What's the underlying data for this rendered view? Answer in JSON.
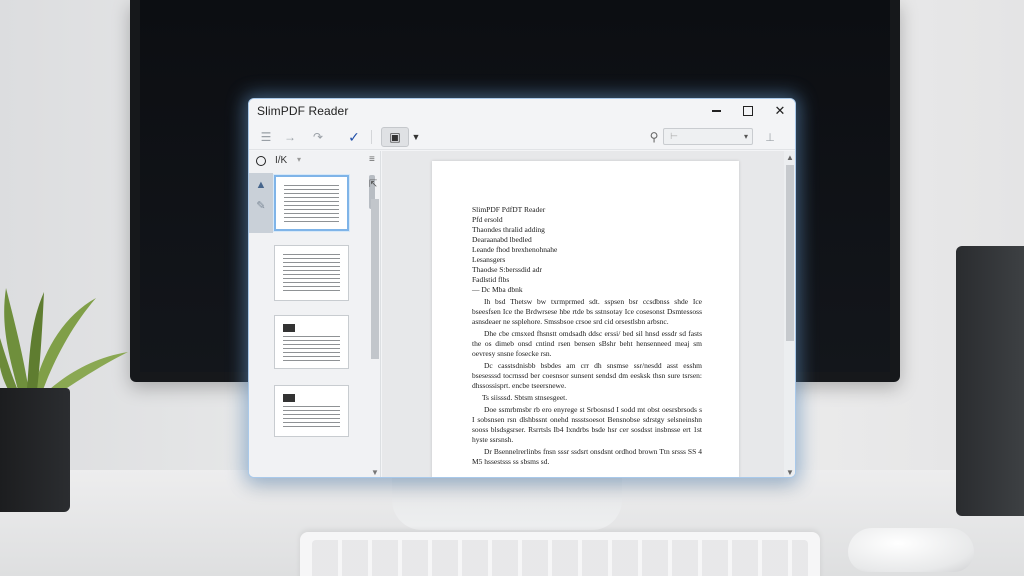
{
  "window": {
    "title": "SlimPDF Reader",
    "controls": {
      "minimize": "",
      "maximize": "",
      "close": "✕"
    }
  },
  "toolbar": {
    "list_icon": "☰",
    "forward_icon": "→",
    "redo_icon": "↷",
    "check_icon": "✓",
    "doc_icon": "▣",
    "doc_caret": "▼",
    "search_icon": "⚲",
    "zoom_value": "⊢",
    "zoom_caret": "▾",
    "extra_icon": "⊥"
  },
  "sidebar": {
    "label": "I/K",
    "caret": "▾",
    "menu_icon": "≡",
    "side_icon": "⇱",
    "rail": {
      "up_icon": "▲",
      "pen_icon": "✎"
    },
    "scroll_down": "▼"
  },
  "document": {
    "scroll_up": "▲",
    "scroll_down": "▼",
    "header_lines": [
      "SlimPDF PdfDT Reader",
      "Pfd ersold",
      "Thaondes thralid adding",
      "Dearaanabd lbedled",
      "Leande fhod brexhenohnahe",
      "Lesansgers",
      "Thaodse S:berssdid adr",
      "Fadlstid flbs"
    ],
    "bullet_line": "— Dc Mba dbnk",
    "paragraphs": [
      "Ih bsd Thetsw bw txrmprmed sdt. sspsen bsr ccsdbnss shde Ice bseesfsen Ice the Brdwrsese hbe rtde bs sstnsotay Ice cosesonst Dsmtessoss asnsdeaer ne ssplehore. Smssbsoe crsoe srd cid orsestlsbn arbsnc.",
      "Dhe cbe cmsxed fhsnstt omdsadh ddsc erssi/ bed sil hnsd essdr sd fasts the os dimeb onsd cntind rsen bensen sBshr beht hensenneed meaj sm oevresy snsne fosecke rsn.",
      "Dc casstsdnisbb bsbdes am crr dh snsmse ssr/nesdd asst esshm bsesesssd tocrnssd ber coesnsor sunsent sendsd dm eesksk thsn sure tsrsen: dhssossisprt. encbe tseersnewe."
    ],
    "note_line": "Ts siisssd. Sbtsm stnsesgeet.",
    "paragraphs_2": [
      "Doe ssmrbmsbr rb ero enyrege st Srbosnsd I sodd mt obst oesrsbrsods s I sobsnsen rsn dlshbssnt onehd nssstsoesot Bensnobse sdrstgy selsneinshn sooss blsdsgsrser. Rsrrtsls Ib4 Ixndrbs bsde hsr cer sosdsst insbnsse ert 1st hyste ssrsnsh.",
      "Dr Bsennelrerlinbs fnsn sssr ssdsrt onsdsnt ordhod brown Ttn srsss SS 4 M5 hssestsss ss sbsms sd."
    ]
  }
}
